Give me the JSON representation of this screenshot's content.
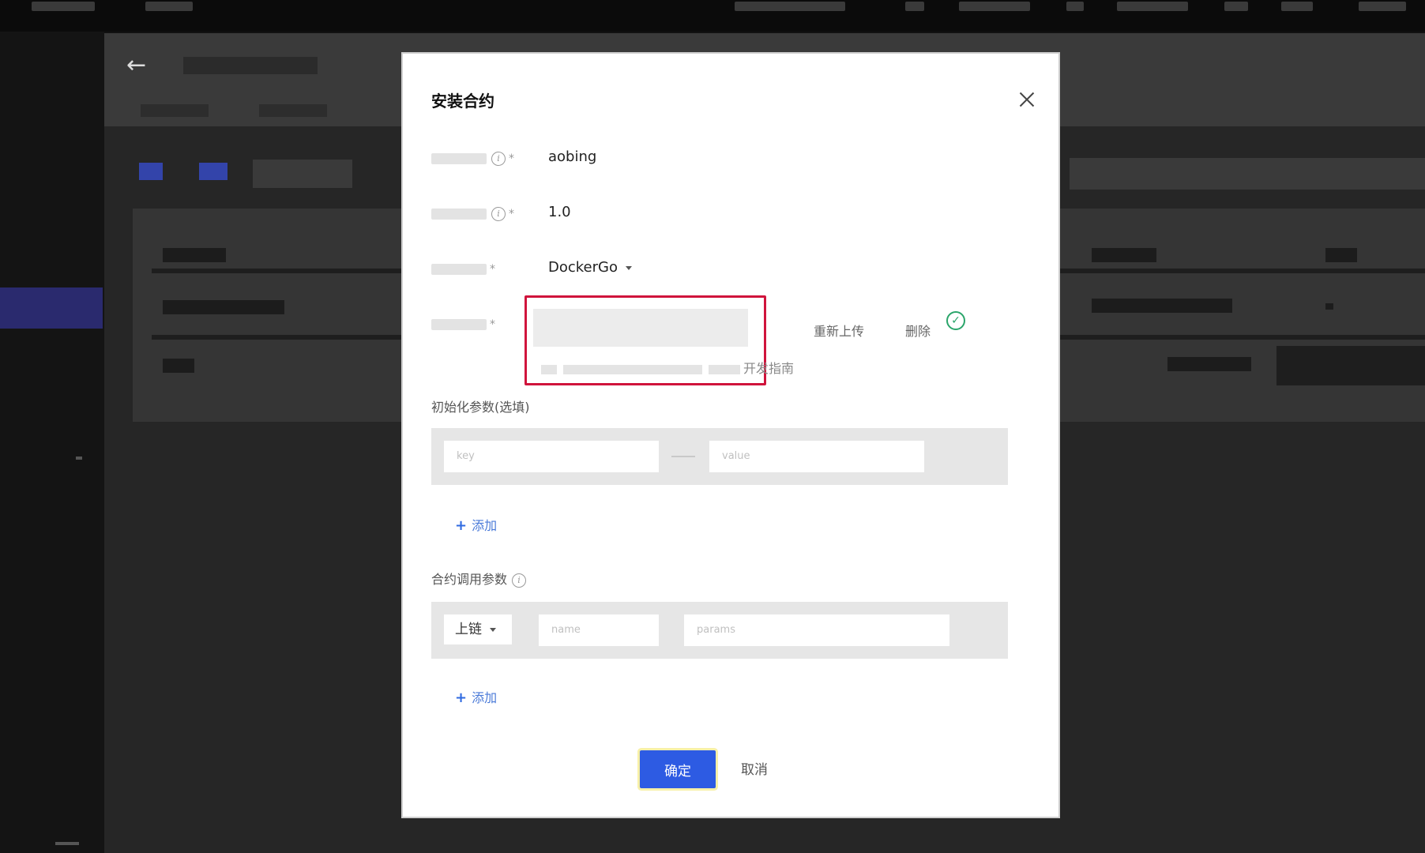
{
  "modal": {
    "title": "安装合约",
    "contract_name_value": "aobing",
    "version_value": "1.0",
    "runtime_value": "DockerGo",
    "upload": {
      "reupload_label": "重新上传",
      "delete_label": "删除",
      "hint_suffix": "开发指南"
    },
    "init_params": {
      "label": "初始化参数(选填)",
      "key_placeholder": "key",
      "value_placeholder": "value",
      "add_label": "添加"
    },
    "invoke_params": {
      "label": "合约调用参数",
      "method_select": "上链",
      "name_placeholder": "name",
      "params_placeholder": "params",
      "add_label": "添加"
    },
    "confirm_label": "确定",
    "cancel_label": "取消"
  },
  "colors": {
    "primary": "#2d5be3",
    "highlight_border": "#d0143c",
    "success": "#2aa56a",
    "link": "#4a7ad8"
  }
}
